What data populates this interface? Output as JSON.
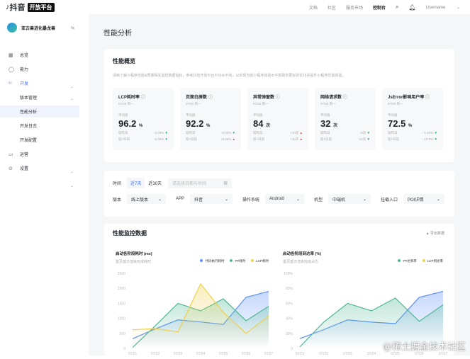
{
  "header": {
    "brand": "抖音",
    "brand_badge": "开放平台",
    "nav": [
      "文档",
      "社区",
      "服务市场",
      "控制台"
    ],
    "active_nav": "控制台",
    "user": "Username"
  },
  "sidebar": {
    "app_name": "亚古兽进化暴龙兽",
    "items": [
      {
        "label": "总览",
        "icon": "grid-icon"
      },
      {
        "label": "能力",
        "icon": "bag-icon"
      },
      {
        "label": "开发",
        "icon": "code-icon"
      },
      {
        "label": "版本管理"
      },
      {
        "label": "性能分析"
      },
      {
        "label": "开发日志"
      },
      {
        "label": "开发配置"
      },
      {
        "label": "运营",
        "icon": "monitor-icon"
      },
      {
        "label": "设置",
        "icon": "settings-icon"
      }
    ]
  },
  "page": {
    "title": "性能分析"
  },
  "overview": {
    "title": "性能概览",
    "desc": "清晰了解小程序性能&质量相关监控数据指标，参考抖音开放平台平均水平线，以反馈当前小程序体验水平帮助你更好的优化并提升小程序性能体验。",
    "avg_label": "平均值",
    "cmp1": "较昨日",
    "cmp2": "较7日前",
    "metrics": [
      {
        "name": "LCP耗时率",
        "date": "07/20 周一",
        "value": "96.2",
        "unit": "%",
        "d1": "-2.03%",
        "d2": "-5.05%",
        "t1": "down",
        "t2": "down"
      },
      {
        "name": "页面白屏数",
        "date": "07/20 周一",
        "value": "92.2",
        "unit": "%",
        "d1": "-0.03%",
        "d2": "+6.05%",
        "t1": "down",
        "t2": "up"
      },
      {
        "name": "异常弹窗数",
        "date": "07/20 周一",
        "value": "84",
        "unit": "次",
        "d1": "+10次",
        "d2": "+20次",
        "t1": "up",
        "t2": "up"
      },
      {
        "name": "网络请求数",
        "date": "07/20 周一",
        "value": "32",
        "unit": "次",
        "d1": "-6次",
        "d2": "-12次",
        "t1": "down",
        "t2": "down"
      },
      {
        "name": "JsError影响用户率",
        "date": "07/20 周一",
        "value": "72.5",
        "unit": "%",
        "d1": "-1.62%",
        "d2": "-12.2%",
        "t1": "down",
        "t2": "down"
      }
    ]
  },
  "filters": {
    "time_label": "时间",
    "ranges": [
      "近7天",
      "近30天"
    ],
    "date_placeholder": "请选择日期与时间",
    "selects": [
      {
        "label": "版本",
        "value": "线上版本"
      },
      {
        "label": "APP",
        "value": "抖音"
      },
      {
        "label": "操作系统",
        "value": "Android"
      },
      {
        "label": "机型",
        "value": "中端机"
      },
      {
        "label": "挂载入口",
        "value": "POI详情"
      }
    ]
  },
  "monitor": {
    "title": "性能监控数据",
    "export": "导出数据"
  },
  "colors": {
    "blue": "#5b8ff9",
    "green": "#4fb893",
    "yellow": "#f0cf4a"
  },
  "chart_data": [
    {
      "type": "area",
      "title": "启动各阶段耗时 (ms)",
      "subtitle": "首页首次渲染完成耗时",
      "x": [
        "07/21",
        "07/22",
        "07/23",
        "07/24",
        "07/25",
        "07/26",
        "07/27"
      ],
      "ylim": [
        0,
        2500
      ],
      "yticks": [
        "0",
        "500",
        "1000",
        "1500",
        "2000",
        "2500"
      ],
      "series": [
        {
          "name": "代码执行耗时",
          "values": [
            320,
            650,
            950,
            880,
            800,
            1700,
            1900
          ]
        },
        {
          "name": "FP耗时",
          "values": [
            30,
            750,
            1500,
            1250,
            1650,
            920,
            1400
          ]
        },
        {
          "name": "LCP耗时",
          "values": [
            620,
            660,
            550,
            2150,
            1200,
            500,
            1080
          ]
        }
      ]
    },
    {
      "type": "area",
      "title": "启动各阶段到达率 (%)",
      "subtitle": "首页首次渲染完成占比",
      "x": [
        "07/21",
        "07/22",
        "07/23",
        "07/24",
        "07/25",
        "07/26",
        "07/27"
      ],
      "ylim": [
        0,
        100
      ],
      "yticks": [
        "0",
        "20%",
        "40%",
        "60%",
        "80%",
        "100%"
      ],
      "series": [
        {
          "name": "FP达到率",
          "values": [
            13,
            25,
            38,
            35,
            33,
            68,
            76
          ]
        },
        {
          "name": "LCP到达率",
          "values": [
            2,
            35,
            60,
            50,
            67,
            36,
            58
          ]
        }
      ]
    }
  ],
  "watermark": "@稀土掘金技术社区"
}
